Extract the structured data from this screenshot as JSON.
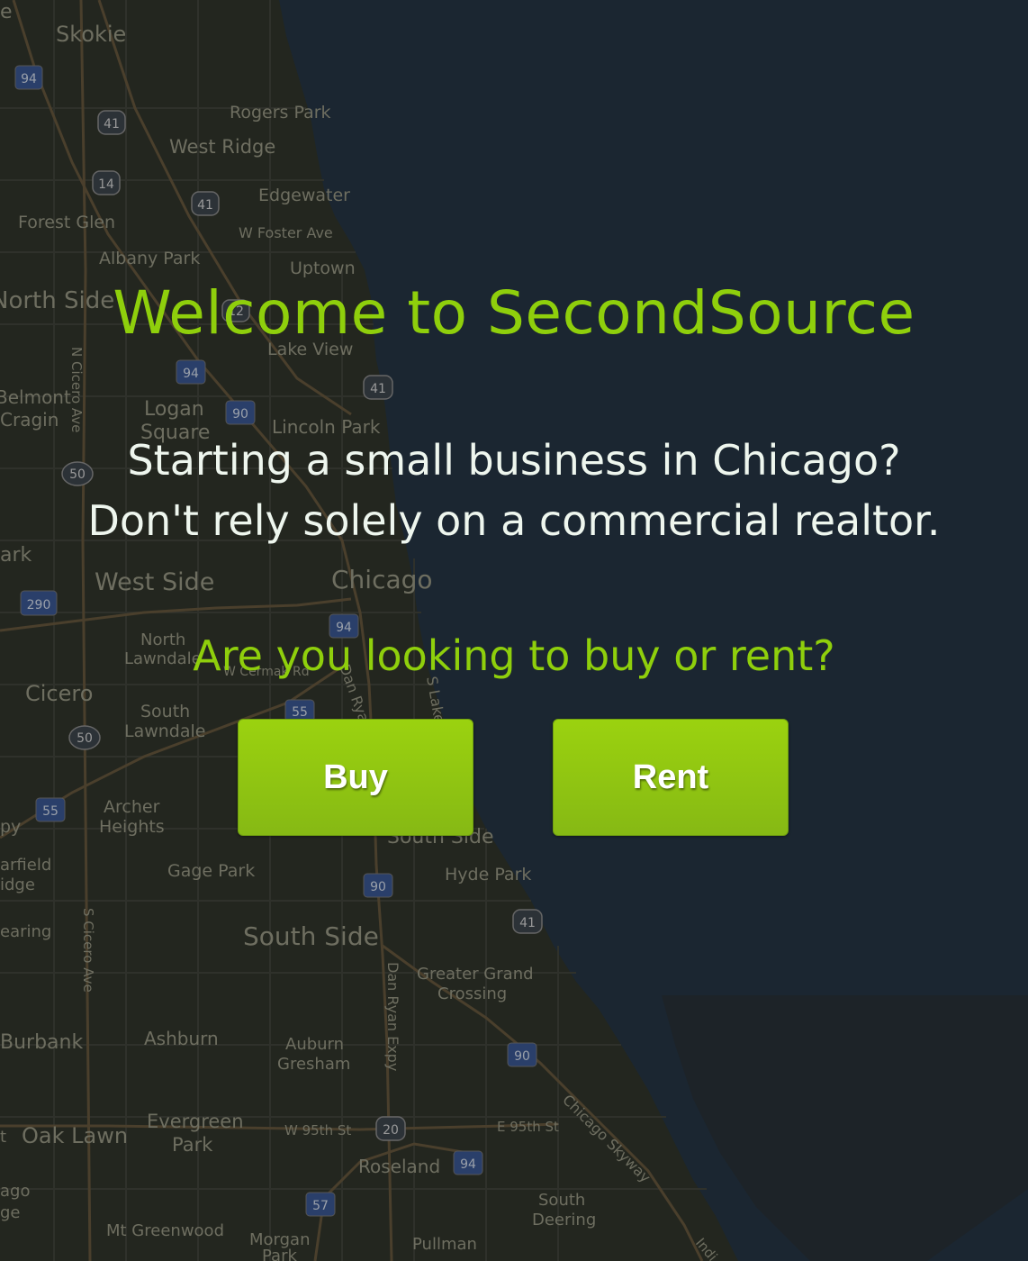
{
  "hero": {
    "title": "Welcome to SecondSource",
    "tagline_line1": "Starting a small business in Chicago?",
    "tagline_line2": "Don't rely solely on a commercial realtor.",
    "question": "Are you looking to buy or rent?"
  },
  "buttons": {
    "buy": "Buy",
    "rent": "Rent"
  },
  "map": {
    "labels": {
      "skokie": "Skokie",
      "rogers_park": "Rogers Park",
      "west_ridge": "West Ridge",
      "edgewater": "Edgewater",
      "forest_glen": "Forest Glen",
      "w_foster_ave": "W Foster Ave",
      "albany_park": "Albany Park",
      "uptown": "Uptown",
      "north_side": "North Side",
      "lake_view": "Lake View",
      "belmont_cragin_1": "Belmont",
      "belmont_cragin_2": "Cragin",
      "logan_square_1": "Logan",
      "logan_square_2": "Square",
      "lincoln_park": "Lincoln Park",
      "n_cicero_ave": "N Cicero Ave",
      "west_side": "West Side",
      "chicago": "Chicago",
      "north_lawndale_1": "North",
      "north_lawndale_2": "Lawndale",
      "cicero": "Cicero",
      "w_cermak_rd": "W Cermak Rd",
      "dan_ryan_top": "Dan Ryan",
      "s_lake": "S Lake",
      "south_lawndale_1": "South",
      "south_lawndale_2": "Lawndale",
      "archer_heights_1": "Archer",
      "archer_heights_2": "Heights",
      "south_side_mid": "South Side",
      "garfield_ridge_1": "arfield",
      "garfield_ridge_2": "idge",
      "gage_park": "Gage Park",
      "hyde_park": "Hyde Park",
      "clearing": "earing",
      "s_cicero_ave": "S Cicero Ave",
      "south_side": "South Side",
      "dan_ryan_expy": "Dan Ryan Expy",
      "greater_grand_crossing_1": "Greater Grand",
      "greater_grand_crossing_2": "Crossing",
      "burbank": "Burbank",
      "ashburn": "Ashburn",
      "auburn_gresham_1": "Auburn",
      "auburn_gresham_2": "Gresham",
      "chicago_skyway": "Chicago Skyway",
      "oak_lawn": "Oak Lawn",
      "evergreen_park_1": "Evergreen",
      "evergreen_park_2": "Park",
      "w_95th_st": "W 95th St",
      "e_95th_st": "E 95th St",
      "roseland": "Roseland",
      "south_deering_1": "South",
      "south_deering_2": "Deering",
      "mt_greenwood": "Mt Greenwood",
      "morgan_park_1": "Morgan",
      "morgan_park_2": "Park",
      "pullman": "Pullman",
      "indiana": "Indi",
      "west_lawn_frag": "ark",
      "bedford_frag": "py",
      "city_frag_1": "ago",
      "city_frag_2": "ge",
      "top_frag": "e",
      "fragment_st": "t"
    },
    "shields": {
      "i94_a": "94",
      "us41_a": "41",
      "us14": "14",
      "us41_b": "41",
      "i94_b": "94",
      "i90_a": "90",
      "us41_c": "41",
      "r50_a": "50",
      "i290": "290",
      "i94_c": "94",
      "i55_a": "55",
      "r50_b": "50",
      "i55_b": "55",
      "i90_b": "90",
      "us41_d": "41",
      "i90_c": "90",
      "us20": "20",
      "i94_d": "94",
      "i57": "57",
      "us12": "12"
    }
  }
}
